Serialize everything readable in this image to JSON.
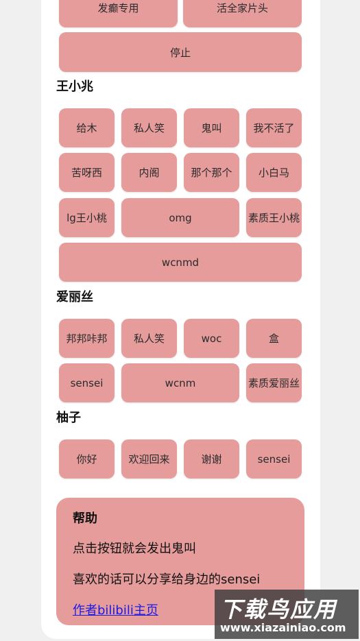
{
  "top_buttons": [
    "发癫专用",
    "活全家片头",
    "停止"
  ],
  "sections": [
    {
      "title": "王小兆",
      "buttons": [
        "给木",
        "私人笑",
        "鬼叫",
        "我不活了",
        "苦呀西",
        "内阁",
        "那个那个",
        "小白马",
        "lg王小桃",
        "omg",
        "素质王小桃",
        "wcnmd"
      ]
    },
    {
      "title": "爱丽丝",
      "buttons": [
        "邦邦咔邦",
        "私人笑",
        "woc",
        "盒",
        "sensei",
        "wcnm",
        "素质爱丽丝"
      ]
    },
    {
      "title": "柚子",
      "buttons": [
        "你好",
        "欢迎回来",
        "谢谢",
        "sensei"
      ]
    }
  ],
  "help": {
    "title": "帮助",
    "line1": "点击按钮就会发出鬼叫",
    "line2": "喜欢的话可以分享给身边的sensei",
    "link": "作者bilibili主页"
  },
  "watermark": {
    "top": "下载鸟应用",
    "bottom": "www.xiazainiao.com"
  },
  "colors": {
    "button": "#e79c9c",
    "card": "#ffffff",
    "background": "#f0f0f0",
    "link": "#1a1ae6"
  }
}
